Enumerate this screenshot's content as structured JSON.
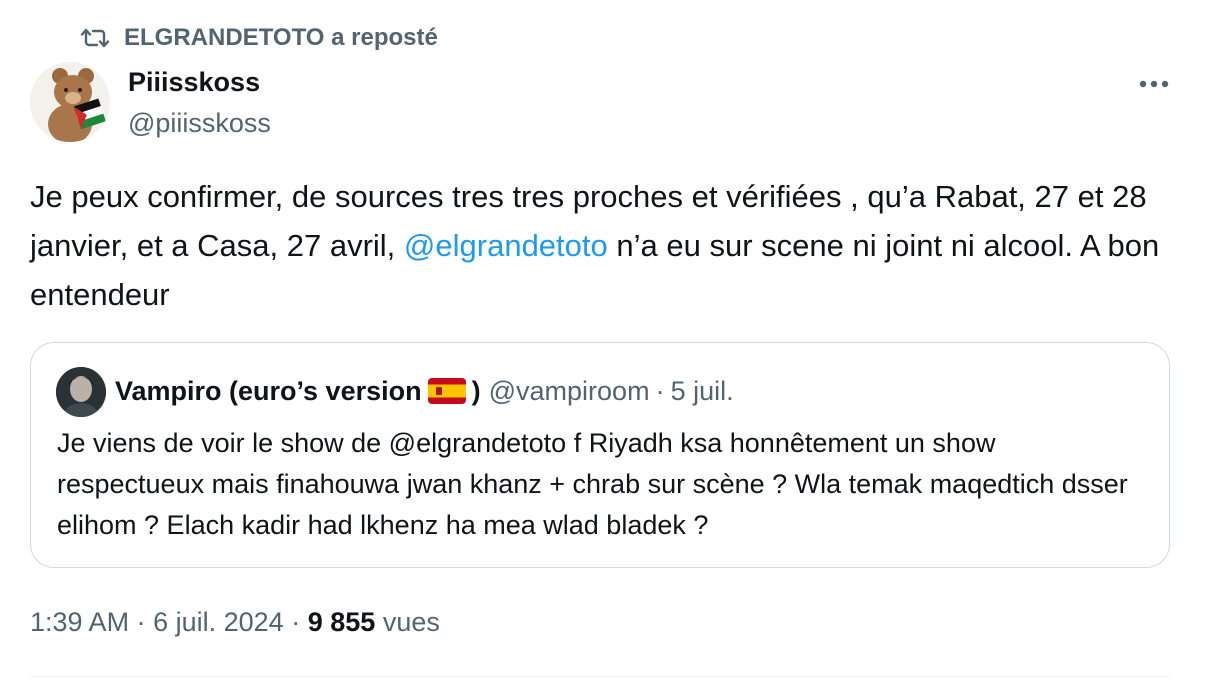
{
  "repost": {
    "text": "ELGRANDETOTO a reposté"
  },
  "author": {
    "name": "Piiisskoss",
    "handle": "@piiisskoss"
  },
  "tweet": {
    "text_before": "Je peux confirmer, de sources tres tres proches et vérifiées , qu’a Rabat, 27 et 28 janvier, et a Casa, 27 avril, ",
    "mention": "@elgrandetoto",
    "text_after": " n’a eu sur scene ni joint ni alcool. A bon entendeur"
  },
  "quote": {
    "name_prefix": "Vampiro (euro’s version",
    "name_suffix": ")",
    "handle": "@vampiroom",
    "separator": "·",
    "time": "5 juil.",
    "text": "Je viens de voir le show de @elgrandetoto f Riyadh ksa honnêtement un show respectueux mais finahouwa jwan khanz + chrab sur scène ? Wla temak maqedtich dsser elihom ? Elach kadir had lkhenz ha mea wlad bladek ?"
  },
  "meta": {
    "time": "1:39 AM",
    "sep1": "·",
    "date": "6 juil. 2024",
    "sep2": "·",
    "views_count": "9 855",
    "views_label": "vues"
  },
  "icons": {
    "repost": "repost-icon",
    "more": "more-icon",
    "flag": "spain-flag-icon"
  },
  "colors": {
    "link": "#1d9bf0",
    "secondary": "#536471",
    "border": "#cfd9de"
  }
}
